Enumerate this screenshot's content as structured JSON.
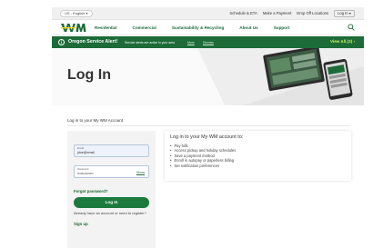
{
  "utility_bar": {
    "language": "US - English ▾",
    "links": [
      "Schedule & ETA",
      "Make a Payment",
      "Drop Off Locations"
    ],
    "login": "Log In ▾"
  },
  "nav": {
    "logo_icon": "wm-logo",
    "items": [
      "Residential",
      "Commercial",
      "Sustainability & Recycling",
      "About Us",
      "Support"
    ],
    "search_icon": "search-icon"
  },
  "alert": {
    "icon": "info-icon",
    "title": "Oregon Service Alert!",
    "message": "Service alerts are active in your area",
    "more": "More",
    "dismiss": "Dismiss",
    "pager": "‹ ›",
    "view_all": "View All (3) ›"
  },
  "hero": {
    "title": "Log In"
  },
  "login": {
    "subtitle": "Log in to your My WM Account",
    "email_label": "Email",
    "email_value": "jdoe@email",
    "password_label": "Password",
    "password_value": "••••••••••••••",
    "show_label": "Show",
    "forgot": "Forgot password?",
    "button": "Log In",
    "already": "Already have an account or need to register?",
    "signup": "Sign up"
  },
  "benefits": {
    "title": "Log in to your My WM account to:",
    "items": [
      "Pay bills",
      "Access pickup and holiday schedules",
      "Save a payment method",
      "Enroll in autopay or paperless billing",
      "Set notification preferences"
    ]
  },
  "colors": {
    "brand_green": "#1c6b38",
    "accent_lime": "#c8f05a"
  }
}
